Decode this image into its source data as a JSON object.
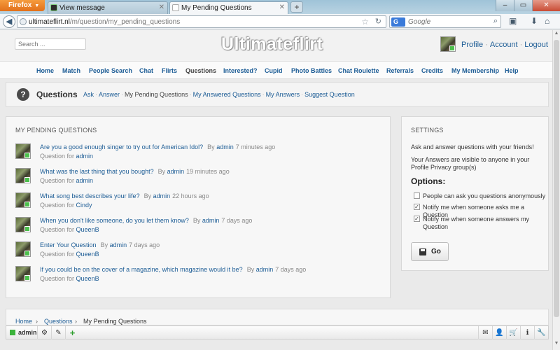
{
  "browser": {
    "menu_label": "Firefox",
    "tabs": [
      {
        "label": "View message",
        "active": false
      },
      {
        "label": "My Pending Questions",
        "active": true
      }
    ],
    "new_tab": "+",
    "url_host": "ultimateflirt.nl",
    "url_path": "/m/question/my_pending_questions",
    "search_engine": "G",
    "search_placeholder": "Google"
  },
  "site": {
    "search_placeholder": "Search ...",
    "logo": "Ultimateflirt",
    "user_links": [
      "Profile",
      "Account",
      "Logout"
    ],
    "nav": [
      "Home",
      "Match",
      "People Search",
      "Chat",
      "Flirts",
      "Questions",
      "Interested?",
      "Cupid",
      "Photo Battles",
      "Chat Roulette",
      "Referrals",
      "Credits",
      "My Membership",
      "Help"
    ],
    "nav_current": "Questions"
  },
  "questions_bar": {
    "icon": "?",
    "title": "Questions",
    "links": [
      "Ask",
      "Answer",
      "My Pending Questions",
      "My Answered Questions",
      "My Answers",
      "Suggest Question"
    ],
    "current": "My Pending Questions"
  },
  "pending": {
    "title": "MY PENDING QUESTIONS",
    "by_label": "By",
    "for_label": "Question for",
    "items": [
      {
        "question": "Are you a good enough singer to try out for American Idol?",
        "by": "admin",
        "time": "7 minutes ago",
        "for": "admin"
      },
      {
        "question": "What was the last thing that you bought?",
        "by": "admin",
        "time": "19 minutes ago",
        "for": "admin"
      },
      {
        "question": "What song best describes your life?",
        "by": "admin",
        "time": "22 hours ago",
        "for": "Cindy"
      },
      {
        "question": "When you don't like someone, do you let them know?",
        "by": "admin",
        "time": "7 days ago",
        "for": "QueenB"
      },
      {
        "question": "Enter Your Question",
        "by": "admin",
        "time": "7 days ago",
        "for": "QueenB"
      },
      {
        "question": "If you could be on the cover of a magazine, which magazine would it be?",
        "by": "admin",
        "time": "7 days ago",
        "for": "QueenB"
      }
    ]
  },
  "settings": {
    "title": "SETTINGS",
    "intro": "Ask and answer questions with your friends!",
    "visibility": "Your Answers are visible to anyone in your Profile Privacy group(s)",
    "options_title": "Options:",
    "options": [
      {
        "label": "People can ask you questions anonymously",
        "checked": false
      },
      {
        "label": "Notify me when someone asks me a Question",
        "checked": true
      },
      {
        "label": "Notify me when someone answers my Question",
        "checked": true
      }
    ],
    "go_label": "Go"
  },
  "breadcrumb": [
    "Home",
    "Questions",
    "My Pending Questions"
  ],
  "breadcrumb_sep": "›",
  "toolbar": {
    "username": "admin"
  },
  "colors": {
    "link": "#1c5c95",
    "online": "#3bb33b",
    "firefox": "#e2701a"
  }
}
